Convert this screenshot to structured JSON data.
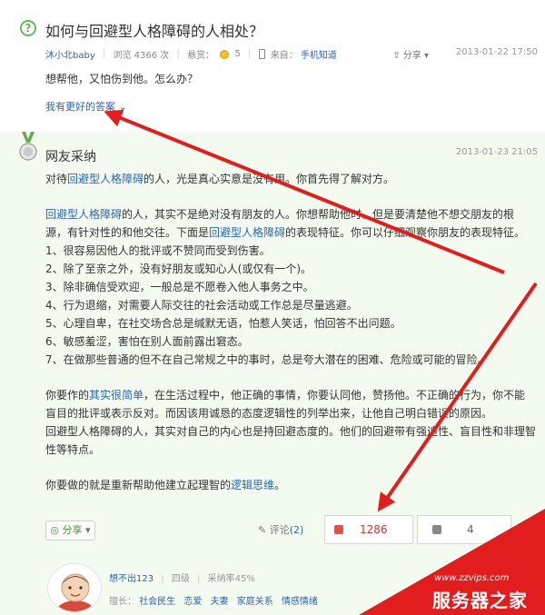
{
  "question": {
    "title": "如何与回避型人格障碍的人相处？",
    "icon": "question-circle-icon",
    "meta": {
      "asker": "沐小北baby",
      "views_label": "浏览 4366 次",
      "reward_label": "悬赏：",
      "reward": "5",
      "source_label": "来自：",
      "source": "手机知道",
      "share_label": "分享",
      "date": "2013-01-22 17:50"
    },
    "body": "想帮他，又怕伤到他。怎么办？",
    "better_answer_label": "我有更好的答案"
  },
  "answer": {
    "title": "网友采纳",
    "date": "2013-01-23 21:05",
    "p1": {
      "a": "对待",
      "kw": "回避型人格障碍",
      "b": "的人，光是真心实意是没有用。你首先得了解对方。"
    },
    "p2": {
      "kw1": "回避型人格障碍",
      "a": "的人，其实不是绝对没有朋友的人。你想帮助他时，但是要清楚他不想交朋友的根源，有针对性的和他交往。下面是",
      "kw2": "回避型人格障碍",
      "b": "的表现特征。你可以仔细观察你朋友的表现特征。"
    },
    "list": [
      "1、很容易因他人的批评或不赞同而受到伤害。",
      "2、除了至亲之外，没有好朋友或知心人(或仅有一个)。",
      "3、除非确信受欢迎，一般总是不愿卷入他人事务之中。",
      "4、行为退缩，对需要人际交往的社会活动或工作总是尽量逃避。",
      "5、心理自卑，在社交场合总是缄默无语，怕惹人笑话，怕回答不出问题。",
      "6、敏感羞涩，害怕在别人面前露出窘态。",
      "7、在做那些普通的但不在自己常规之中的事时，总是夸大潜在的困难、危险或可能的冒险。"
    ],
    "p3": {
      "a": "你要作的",
      "kw": "其实很简单",
      "b": "，在生活过程中，他正确的事情，你要认同他，赞扬他。不正确的行为，你不能盲目的批评或表示反对。而因该用诚恳的态度逻辑性的列举出来，让他自己明白错误的原因。"
    },
    "p4": "回避型人格障碍的人，其实对自己的内心也是持回避态度的。他们的回避带有强迫性、盲目性和非理智性等特点。",
    "p5": {
      "a": "你要做的就是重新帮助他建立起理智的",
      "kw": "逻辑思维",
      "b": "。"
    },
    "share_label": "分享",
    "comment_label": "评论",
    "comment_count": "(2)",
    "upvotes": "1286",
    "downvotes": "4"
  },
  "user": {
    "name": "想不出123",
    "level": "四级",
    "accept_rate": "采纳率45%",
    "field_label": "擅长：",
    "tags": [
      "社会民生",
      "恋爱",
      "夫妻",
      "家庭关系",
      "情感情绪"
    ]
  },
  "watermark": {
    "url": "www.zzvips.com",
    "name": "服务器之家"
  },
  "colors": {
    "link": "#2d64b3",
    "accent_green": "#65b85c",
    "answer_bg": "#f3fbf0",
    "arrow_red": "#e21d1d"
  }
}
